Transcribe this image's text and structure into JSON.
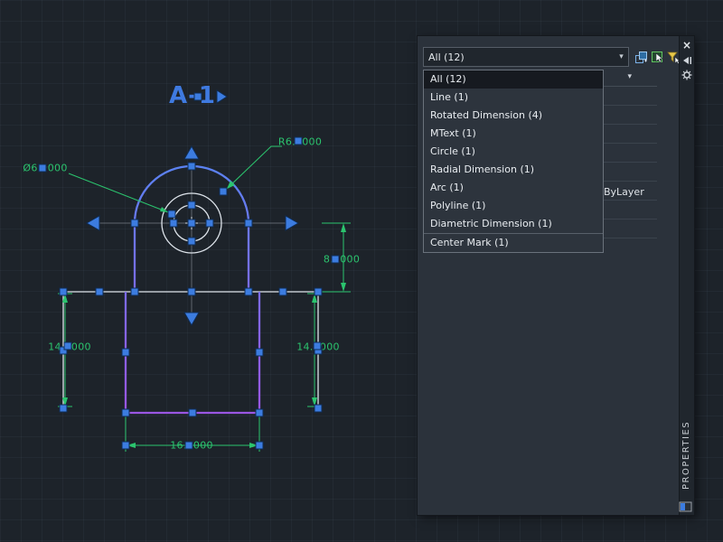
{
  "canvas": {
    "title_text": "A-1",
    "dimensions": {
      "arch_height": "8.0000",
      "left_side": "14.0000",
      "right_side": "14.0000",
      "bottom_width": "16.0000",
      "radius": "R6.0000",
      "diameter": "Ø6.0000"
    },
    "colors": {
      "dimension": "#2bc46e",
      "grip": "#3c7ce0",
      "geometry": "#dde3ea",
      "centerline": "#b9c2cc",
      "polyline_top": "#5b82f2",
      "polyline_bottom": "#9a55e2",
      "title_text": "#3f7ae0"
    }
  },
  "palette": {
    "selector": {
      "value": "All (12)"
    },
    "chevron_down": "▾",
    "dropdown_items": [
      "All (12)",
      "Line (1)",
      "Rotated Dimension (4)",
      "MText (1)",
      "Circle (1)",
      "Radial Dimension (1)",
      "Arc (1)",
      "Polyline (1)",
      "Diametric Dimension (1)",
      "Center Mark (1)"
    ],
    "properties_preview": {
      "value": "ByLayer"
    },
    "titlebar": {
      "title": "PROPERTIES",
      "close_glyph": "×"
    }
  }
}
